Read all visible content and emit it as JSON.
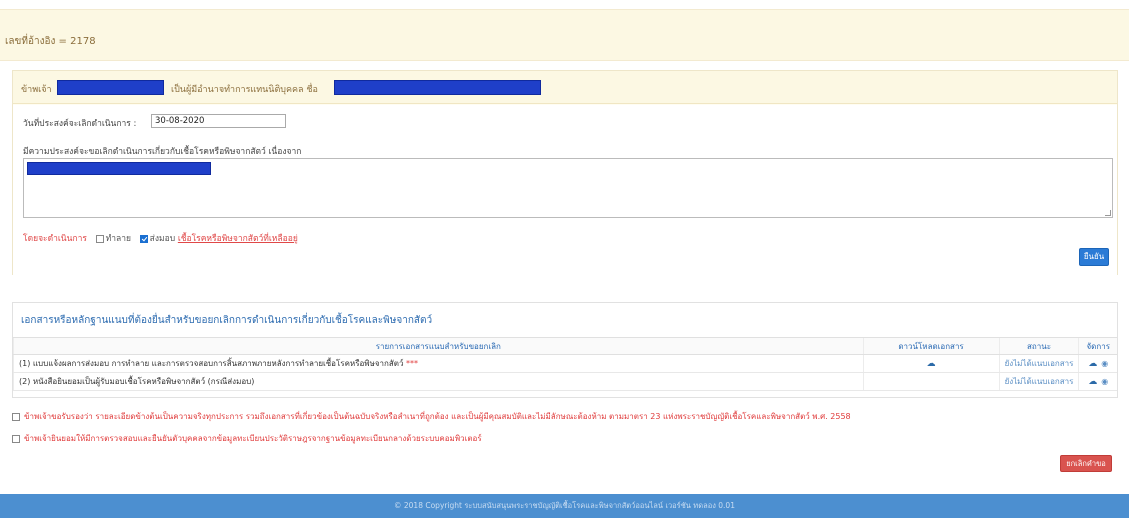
{
  "reference": {
    "label": "เลขที่อ้างอิง = 2178"
  },
  "form": {
    "prefix": "ข้าพเจ้า",
    "middle": "เป็นผู้มีอำนาจทำการแทนนิติบุคคล ชื่อ",
    "date_label": "วันที่ประสงค์จะเลิกดำเนินการ :",
    "date_value": "30-08-2020",
    "reason_label": "มีความประสงค์จะขอเลิกดำเนินการเกี่ยวกับเชื้อโรคหรือพิษจากสัตว์ เนื่องจาก",
    "method_label": "โดยจะดำเนินการ",
    "option_destroy": "ทำลาย",
    "option_deliver": "ส่งมอบ",
    "option_destroy_checked": false,
    "option_deliver_checked": true,
    "remaining_link": "เชื้อโรคหรือพิษจากสัตว์ที่เหลืออยู่",
    "confirm_button": "ยืนยัน"
  },
  "documents": {
    "title": "เอกสารหรือหลักฐานแนบที่ต้องยื่นสำหรับขอยกเลิกการดำเนินการเกี่ยวกับเชื้อโรคและพิษจากสัตว์",
    "headers": {
      "name": "รายการเอกสารแนบสำหรับขอยกเลิก",
      "download": "ดาวน์โหลดเอกสาร",
      "status": "สถานะ",
      "action": "จัดการ"
    },
    "rows": [
      {
        "name": "(1) แบบแจ้งผลการส่งมอบ การทำลาย และการตรวจสอบการสิ้นสภาพภายหลังการทำลายเชื้อโรคหรือพิษจากสัตว์",
        "required": "***",
        "has_download": true,
        "status": "ยังไม่ได้แนบเอกสาร"
      },
      {
        "name": "(2) หนังสือยินยอมเป็นผู้รับมอบเชื้อโรคหรือพิษจากสัตว์ (กรณีส่งมอบ)",
        "required": "",
        "has_download": false,
        "status": "ยังไม่ได้แนบเอกสาร"
      }
    ]
  },
  "declarations": {
    "certify": "ข้าพเจ้าขอรับรองว่า รายละเอียดข้างต้นเป็นความจริงทุกประการ รวมถึงเอกสารที่เกี่ยวข้องเป็นต้นฉบับจริงหรือสำเนาที่ถูกต้อง และเป็นผู้มีคุณสมบัติและไม่มีลักษณะต้องห้าม ตามมาตรา 23 แห่งพระราชบัญญัติเชื้อโรคและพิษจากสัตว์ พ.ศ. 2558",
    "consent": "ข้าพเจ้ายินยอมให้มีการตรวจสอบและยืนยันตัวบุคคลจากข้อมูลทะเบียนประวัติราษฎรจากฐานข้อมูลทะเบียนกลางด้วยระบบคอมพิวเตอร์"
  },
  "cancel_button": "ยกเลิกคำขอ",
  "footer": {
    "copyright": "© 2018 Copyright ระบบสนับสนุนพระราชบัญญัติเชื้อโรคและพิษจากสัตว์ออนไลน์ เวอร์ชัน ทดลอง 0.01"
  },
  "colors": {
    "banner": "#fcf8e3",
    "redaction": "#1f3fc9",
    "link_blue": "#2c6bb0",
    "danger": "#d9534f",
    "footer": "#4c8fd0"
  },
  "icons": {
    "download": "cloud-download-icon",
    "view": "eye-icon"
  }
}
